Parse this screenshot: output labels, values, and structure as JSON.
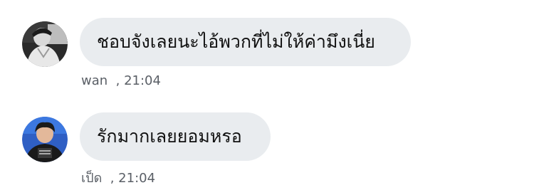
{
  "messages": [
    {
      "text": "ชอบจังเลยนะไอ้พวกที่ไม่ให้ค่ามึงเนี่ย",
      "sender": "wan",
      "time": "21:04",
      "avatar_icon": "user-avatar-grayscale"
    },
    {
      "text": "รักมากเลยยอมหรอ",
      "sender": "เป็ด",
      "time": "21:04",
      "avatar_icon": "user-avatar-color"
    }
  ]
}
